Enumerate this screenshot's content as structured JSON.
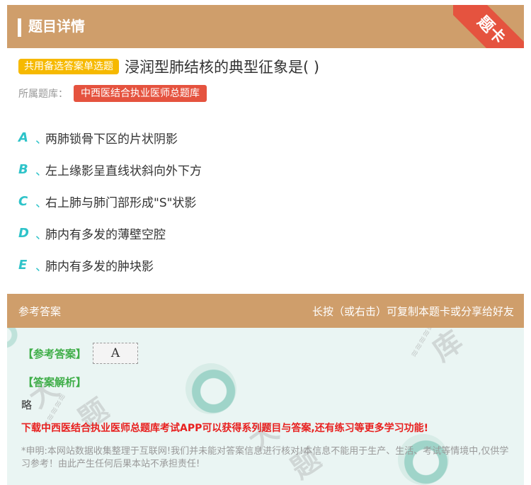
{
  "header": {
    "title": "题目详情",
    "corner_label": "题卡"
  },
  "question": {
    "type_badge": "共用备选答案单选题",
    "text": "浸润型肺结核的典型征象是( )",
    "bank_label": "所属题库：",
    "bank_name": "中西医结合执业医师总题库"
  },
  "options": [
    {
      "letter": "A",
      "sep": "、",
      "text": "两肺锁骨下区的片状阴影"
    },
    {
      "letter": "B",
      "sep": "、",
      "text": "左上缘影呈直线状斜向外下方"
    },
    {
      "letter": "C",
      "sep": "、",
      "text": "右上肺与肺门部形成\"S\"状影"
    },
    {
      "letter": "D",
      "sep": "、",
      "text": "肺内有多发的薄壁空腔"
    },
    {
      "letter": "E",
      "sep": "、",
      "text": "肺内有多发的肿块影"
    }
  ],
  "answer_section": {
    "title": "参考答案",
    "hint": "长按（或右击）可复制本题卡或分享给好友",
    "answer_label": "【参考答案】",
    "answer_value": "A",
    "explanation_label": "【答案解析】",
    "explanation_text": "略",
    "promo": "下载中西医结合执业医师总题库考试APP可以获得系列题目与答案,还有练习等更多学习功能!",
    "disclaimer": "*申明:本网站数据收集整理于互联网!我们并未能对答案信息进行核对!本信息不能用于生产、生活、考试等情境中,仅供学习参考！由此产生任何后果本站不承担责任!"
  },
  "colors": {
    "header_bg": "#cf9e6b",
    "accent_teal": "#2ec3c9",
    "badge_yellow": "#f6b900",
    "badge_red": "#e5533f",
    "answer_green": "#3fae49",
    "promo_red": "#e8201f"
  }
}
